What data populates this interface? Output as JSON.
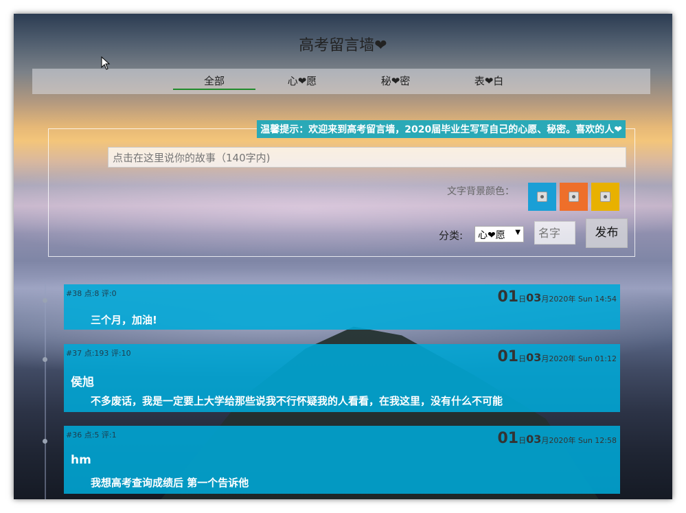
{
  "title": "高考留言墙❤",
  "nav": [
    {
      "label": "全部",
      "active": true
    },
    {
      "label": "心❤愿",
      "active": false
    },
    {
      "label": "秘❤密",
      "active": false
    },
    {
      "label": "表❤白",
      "active": false
    }
  ],
  "hint": "温馨提示：欢迎来到高考留言墙，2020届毕业生写写自己的心愿、秘密。喜欢的人❤",
  "story_placeholder": "点击在这里说你的故事（140字内)",
  "color_label": "文字背景颜色：",
  "colors": [
    "#1a9fd6",
    "#ee6f2a",
    "#e8b100"
  ],
  "category_label": "分类:",
  "category_value": "心❤愿",
  "name_placeholder": "名字",
  "publish_label": "发布",
  "posts": [
    {
      "meta": "#38 点:8 评:0",
      "day": "01",
      "day_unit": "日",
      "month": "03",
      "month_unit": "月",
      "rest": "2020年 Sun 14:54",
      "author": "",
      "content": "三个月，加油!"
    },
    {
      "meta": "#37 点:193 评:10",
      "day": "01",
      "day_unit": "日",
      "month": "03",
      "month_unit": "月",
      "rest": "2020年 Sun 01:12",
      "author": "侯旭",
      "content": "不多废话，我是一定要上大学给那些说我不行怀疑我的人看看，在我这里，没有什么不可能"
    },
    {
      "meta": "#36 点:5 评:1",
      "day": "01",
      "day_unit": "日",
      "month": "03",
      "month_unit": "月",
      "rest": "2020年 Sun 12:58",
      "author": "hm",
      "content": "我想高考查询成绩后 第一个告诉他"
    }
  ]
}
